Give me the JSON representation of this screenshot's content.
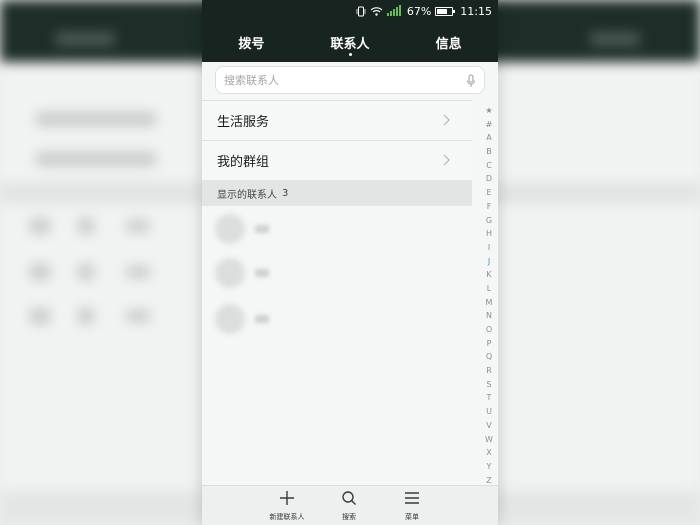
{
  "status_bar": {
    "battery_percent": "67%",
    "battery_level": 0.67,
    "time": "11:15"
  },
  "tabs": [
    {
      "label": "拨号",
      "active": false
    },
    {
      "label": "联系人",
      "active": true
    },
    {
      "label": "信息",
      "active": false
    }
  ],
  "search": {
    "placeholder": "搜索联系人"
  },
  "list_items": [
    {
      "label": "生活服务"
    },
    {
      "label": "我的群组"
    }
  ],
  "section_header": {
    "label": "显示的联系人",
    "count": "3"
  },
  "alphabet_index": [
    "★",
    "#",
    "A",
    "B",
    "C",
    "D",
    "E",
    "F",
    "G",
    "H",
    "I",
    "J",
    "K",
    "L",
    "M",
    "N",
    "O",
    "P",
    "Q",
    "R",
    "S",
    "T",
    "U",
    "V",
    "W",
    "X",
    "Y",
    "Z"
  ],
  "active_letter": "J",
  "bottom_actions": [
    {
      "label": "新建联系人",
      "icon": "plus-icon"
    },
    {
      "label": "搜索",
      "icon": "search-icon"
    },
    {
      "label": "菜单",
      "icon": "menu-icon"
    }
  ],
  "colors": {
    "header_bg": "#17241f",
    "accent": "#2f9bd6",
    "page_bg": "#f5f6f6"
  }
}
